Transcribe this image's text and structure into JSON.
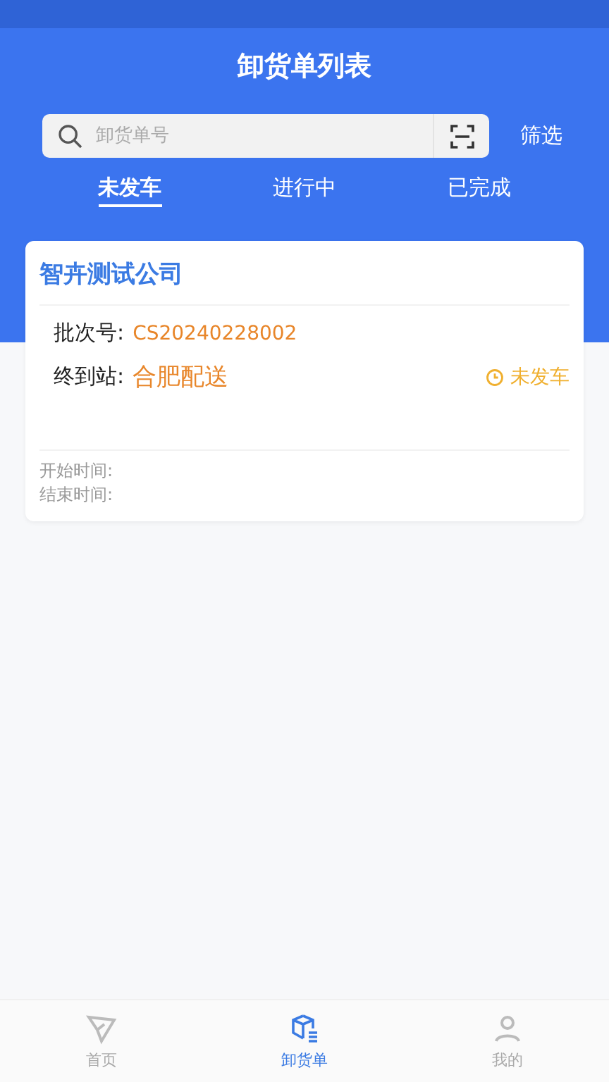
{
  "header": {
    "title": "卸货单列表"
  },
  "search": {
    "placeholder": "卸货单号",
    "filter": "筛选"
  },
  "tabs": [
    {
      "label": "未发车",
      "selected": true
    },
    {
      "label": "进行中",
      "selected": false
    },
    {
      "label": "已完成",
      "selected": false
    }
  ],
  "orders": [
    {
      "company": "智卉测试公司",
      "batch_label": "批次号:",
      "batch": "CS20240228002",
      "station_label": "终到站:",
      "station": "合肥配送",
      "status": "未发车",
      "start_label": "开始时间:",
      "end_label": "结束时间:"
    }
  ],
  "bottom_nav": [
    {
      "label": "首页",
      "kind": "send",
      "selected": false
    },
    {
      "label": "卸货单",
      "kind": "box",
      "selected": true
    },
    {
      "label": "我的",
      "kind": "user",
      "selected": false
    }
  ]
}
